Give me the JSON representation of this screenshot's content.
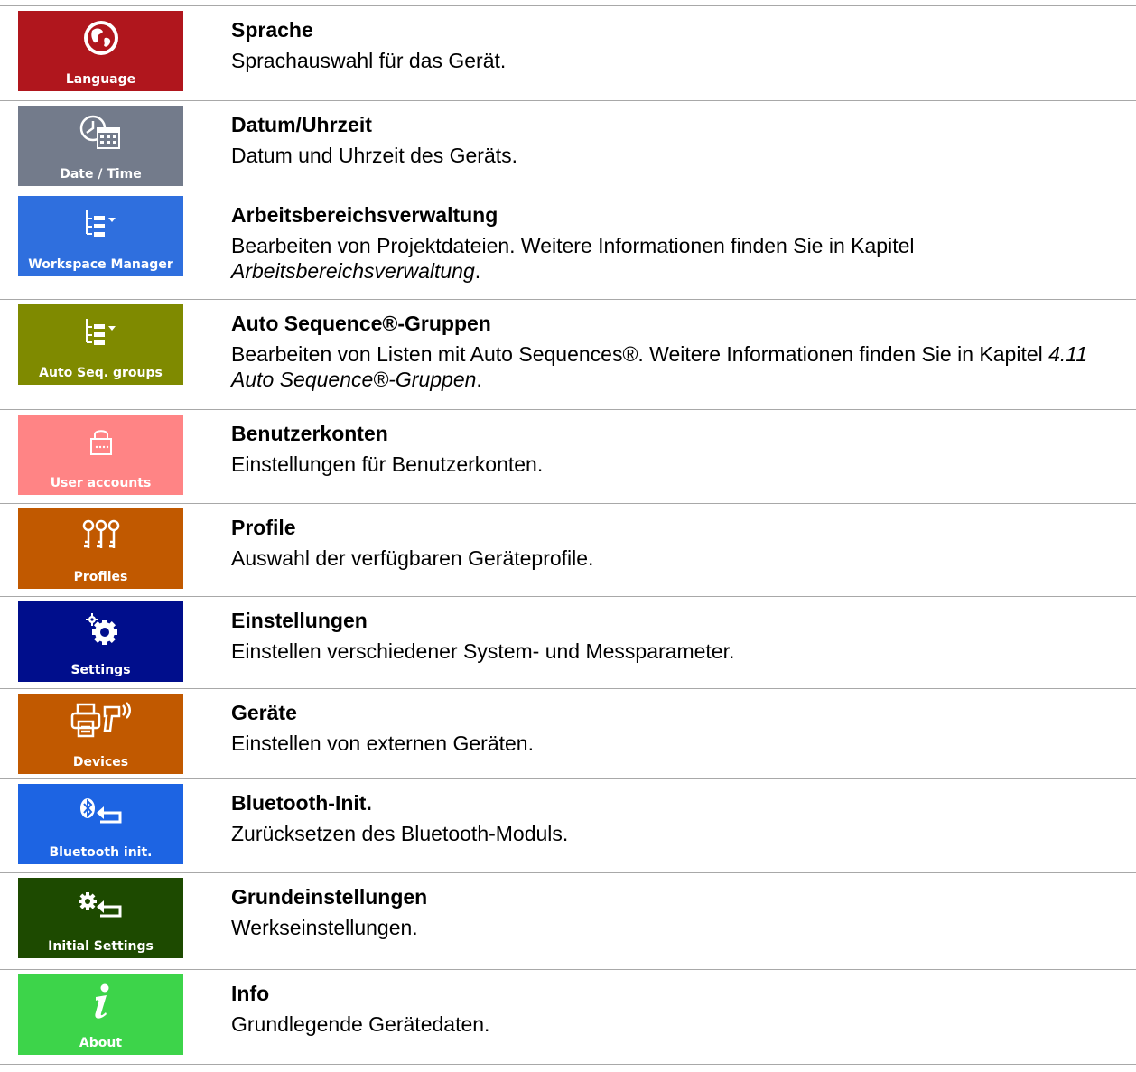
{
  "items": [
    {
      "tile_label": "Language",
      "tile_color": "#b0161d",
      "icon": "globe-icon",
      "title": "Sprache",
      "desc_before": "Sprachauswahl für das Gerät.",
      "desc_italic": "",
      "desc_after": ""
    },
    {
      "tile_label": "Date / Time",
      "tile_color": "#737b8b",
      "icon": "clock-calendar-icon",
      "title": "Datum/Uhrzeit",
      "desc_before": "Datum und Uhrzeit des Geräts.",
      "desc_italic": "",
      "desc_after": ""
    },
    {
      "tile_label": "Workspace Manager",
      "tile_color": "#2f6fde",
      "icon": "tree-list-icon",
      "title": "Arbeitsbereichsverwaltung",
      "desc_before": "Bearbeiten von Projektdateien. Weitere Informationen finden Sie in Kapitel ",
      "desc_italic": "Arbeitsbereichsverwaltung",
      "desc_after": "."
    },
    {
      "tile_label": "Auto Seq. groups",
      "tile_color": "#7f8a00",
      "icon": "tree-list-icon",
      "title": "Auto Sequence®-Gruppen",
      "desc_before": "Bearbeiten von Listen mit Auto Sequences®. Weitere Informationen finden Sie in Kapitel ",
      "desc_italic": "4.11 Auto Sequence®-Gruppen",
      "desc_after": "."
    },
    {
      "tile_label": "User accounts",
      "tile_color": "#ff8485",
      "icon": "lock-icon",
      "title": "Benutzerkonten",
      "desc_before": "Einstellungen für Benutzerkonten.",
      "desc_italic": "",
      "desc_after": ""
    },
    {
      "tile_label": "Profiles",
      "tile_color": "#c15900",
      "icon": "keys-icon",
      "title": "Profile",
      "desc_before": "Auswahl der verfügbaren Geräteprofile.",
      "desc_italic": "",
      "desc_after": ""
    },
    {
      "tile_label": "Settings",
      "tile_color": "#000e8c",
      "icon": "gears-icon",
      "title": "Einstellungen",
      "desc_before": "Einstellen verschiedener System- und Messparameter.",
      "desc_italic": "",
      "desc_after": ""
    },
    {
      "tile_label": "Devices",
      "tile_color": "#c15900",
      "icon": "printer-scanner-icon",
      "title": "Geräte",
      "desc_before": "Einstellen von externen Geräten.",
      "desc_italic": "",
      "desc_after": ""
    },
    {
      "tile_label": "Bluetooth init.",
      "tile_color": "#1d64e3",
      "icon": "bluetooth-reset-icon",
      "title": "Bluetooth-Init.",
      "desc_before": "Zurücksetzen des Bluetooth-Moduls.",
      "desc_italic": "",
      "desc_after": ""
    },
    {
      "tile_label": "Initial Settings",
      "tile_color": "#1d4a00",
      "icon": "gear-reset-icon",
      "title": "Grundeinstellungen",
      "desc_before": "Werkseinstellungen.",
      "desc_italic": "",
      "desc_after": ""
    },
    {
      "tile_label": "About",
      "tile_color": "#3dd44a",
      "icon": "info-icon",
      "title": "Info",
      "desc_before": "Grundlegende Gerätedaten.",
      "desc_italic": "",
      "desc_after": ""
    }
  ]
}
